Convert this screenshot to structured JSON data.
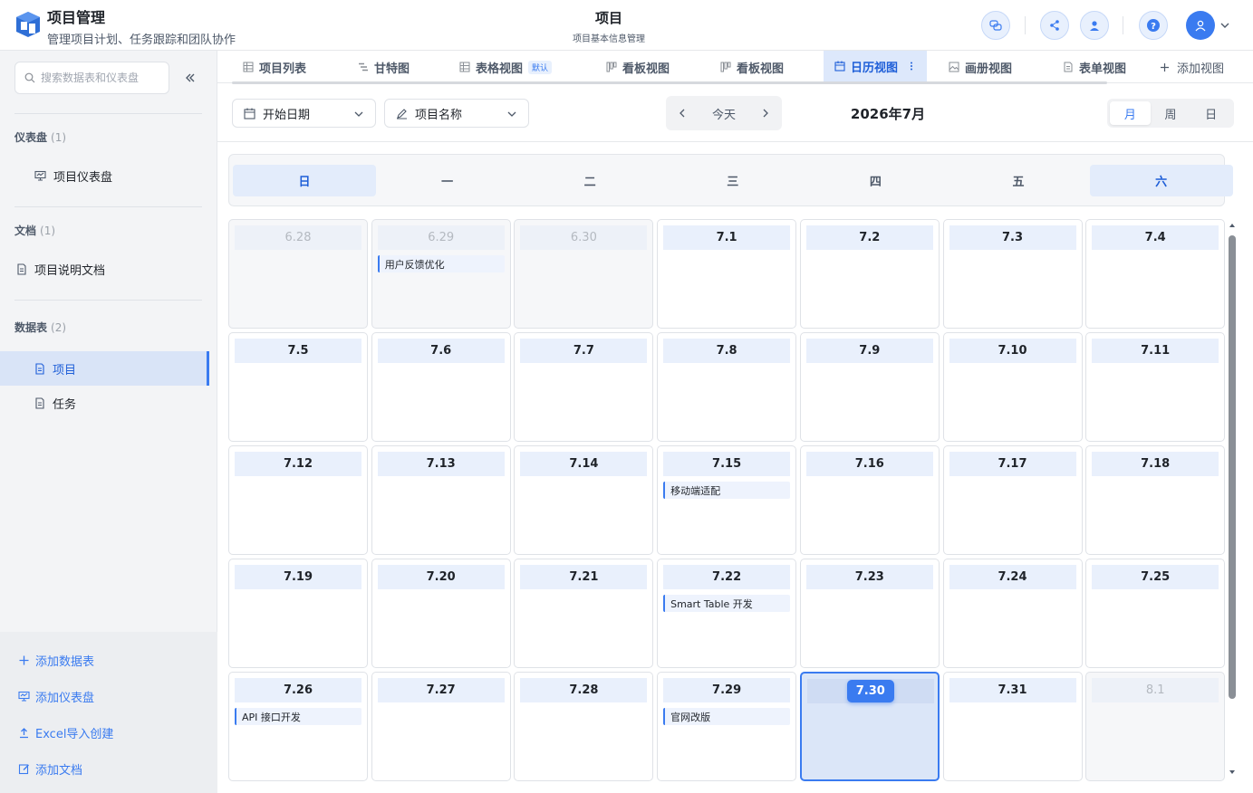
{
  "header": {
    "app_title": "项目管理",
    "app_subtitle": "管理项目计划、任务跟踪和团队协作",
    "page_title": "项目",
    "page_subtitle": "项目基本信息管理"
  },
  "sidebar": {
    "search_placeholder": "搜索数据表和仪表盘",
    "sections": {
      "dashboard": {
        "label": "仪表盘",
        "count": "(1)",
        "items": [
          {
            "label": "项目仪表盘"
          }
        ]
      },
      "docs": {
        "label": "文档",
        "count": "(1)",
        "items": [
          {
            "label": "项目说明文档"
          }
        ]
      },
      "tables": {
        "label": "数据表",
        "count": "(2)",
        "items": [
          {
            "label": "项目"
          },
          {
            "label": "任务"
          }
        ]
      }
    },
    "actions": {
      "add_table": "添加数据表",
      "add_dashboard": "添加仪表盘",
      "excel_import": "Excel导入创建",
      "add_doc": "添加文档"
    }
  },
  "tabs": {
    "items": [
      {
        "label": "项目列表"
      },
      {
        "label": "甘特图"
      },
      {
        "label": "表格视图",
        "badge": "默认"
      },
      {
        "label": "看板视图"
      },
      {
        "label": "看板视图"
      },
      {
        "label": "日历视图"
      },
      {
        "label": "画册视图"
      },
      {
        "label": "表单视图"
      }
    ],
    "add_view": "添加视图"
  },
  "toolbar": {
    "start_date": "开始日期",
    "project_name": "项目名称",
    "today": "今天",
    "month": "2026年7月",
    "mode": {
      "month": "月",
      "week": "周",
      "day": "日"
    }
  },
  "calendar": {
    "weekdays": [
      "日",
      "一",
      "二",
      "三",
      "四",
      "五",
      "六"
    ],
    "rows": [
      [
        {
          "d": "6.28",
          "o": true
        },
        {
          "d": "6.29",
          "o": true,
          "e": "用户反馈优化"
        },
        {
          "d": "6.30",
          "o": true
        },
        {
          "d": "7.1"
        },
        {
          "d": "7.2"
        },
        {
          "d": "7.3"
        },
        {
          "d": "7.4"
        }
      ],
      [
        {
          "d": "7.5"
        },
        {
          "d": "7.6"
        },
        {
          "d": "7.7"
        },
        {
          "d": "7.8"
        },
        {
          "d": "7.9"
        },
        {
          "d": "7.10"
        },
        {
          "d": "7.11"
        }
      ],
      [
        {
          "d": "7.12"
        },
        {
          "d": "7.13"
        },
        {
          "d": "7.14"
        },
        {
          "d": "7.15",
          "e": "移动端适配"
        },
        {
          "d": "7.16"
        },
        {
          "d": "7.17"
        },
        {
          "d": "7.18"
        }
      ],
      [
        {
          "d": "7.19"
        },
        {
          "d": "7.20"
        },
        {
          "d": "7.21"
        },
        {
          "d": "7.22",
          "e": "Smart Table 开发"
        },
        {
          "d": "7.23"
        },
        {
          "d": "7.24"
        },
        {
          "d": "7.25"
        }
      ],
      [
        {
          "d": "7.26",
          "e": "API 接口开发"
        },
        {
          "d": "7.27"
        },
        {
          "d": "7.28"
        },
        {
          "d": "7.29",
          "e": "官网改版"
        },
        {
          "d": "7.30",
          "t": true
        },
        {
          "d": "7.31"
        },
        {
          "d": "8.1",
          "o": true
        }
      ]
    ]
  },
  "colors": {
    "accent": "#3a7bf0",
    "active_bg": "#d9e4f7"
  }
}
